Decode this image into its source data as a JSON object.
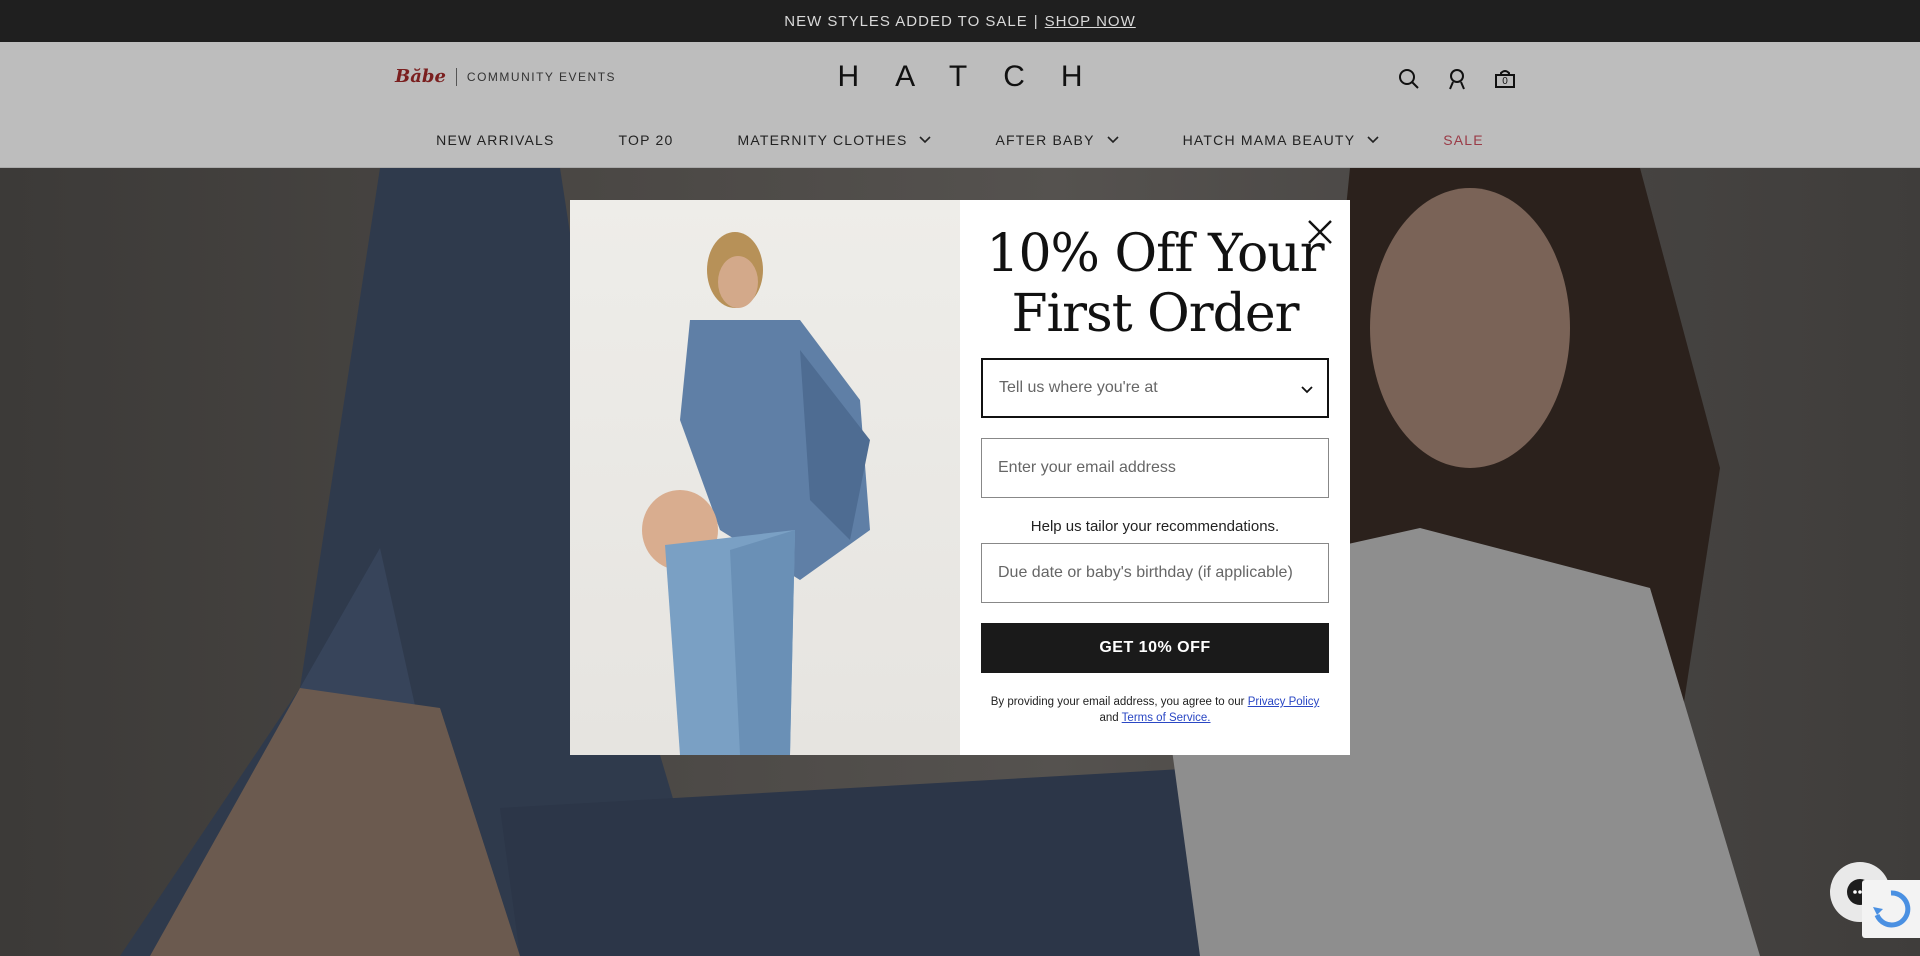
{
  "announcement": {
    "text": "NEW STYLES ADDED TO SALE",
    "separator": "|",
    "link": "SHOP NOW"
  },
  "header": {
    "partner_logo": "Băbe",
    "partner_sub": "COMMUNITY EVENTS",
    "logo": "HATCH",
    "icons": [
      "search-icon",
      "account-icon",
      "cart-icon"
    ],
    "cart_count": "0"
  },
  "nav": {
    "items": [
      {
        "label": "NEW ARRIVALS",
        "dropdown": false
      },
      {
        "label": "TOP 20",
        "dropdown": false
      },
      {
        "label": "MATERNITY CLOTHES",
        "dropdown": true
      },
      {
        "label": "AFTER BABY",
        "dropdown": true
      },
      {
        "label": "HATCH MAMA BEAUTY",
        "dropdown": true
      },
      {
        "label": "SALE",
        "dropdown": false
      }
    ],
    "sale_color": "#9a3b47"
  },
  "modal": {
    "headline_line1": "10% Off Your",
    "headline_line2": "First Order",
    "location_placeholder": "Tell us where you're at",
    "email_placeholder": "Enter your email address",
    "help_text": "Help us tailor your recommendations.",
    "due_date_placeholder": "Due date or baby's birthday (if applicable)",
    "cta_label": "GET 10% OFF",
    "legal_prefix": "By providing your email address, you agree to our",
    "privacy_link": "Privacy Policy",
    "legal_and": "and",
    "terms_link": "Terms of Service."
  },
  "colors": {
    "announce_bg": "#1f1f1f",
    "cta_bg": "#1a1a1a",
    "link": "#2a47c4"
  }
}
